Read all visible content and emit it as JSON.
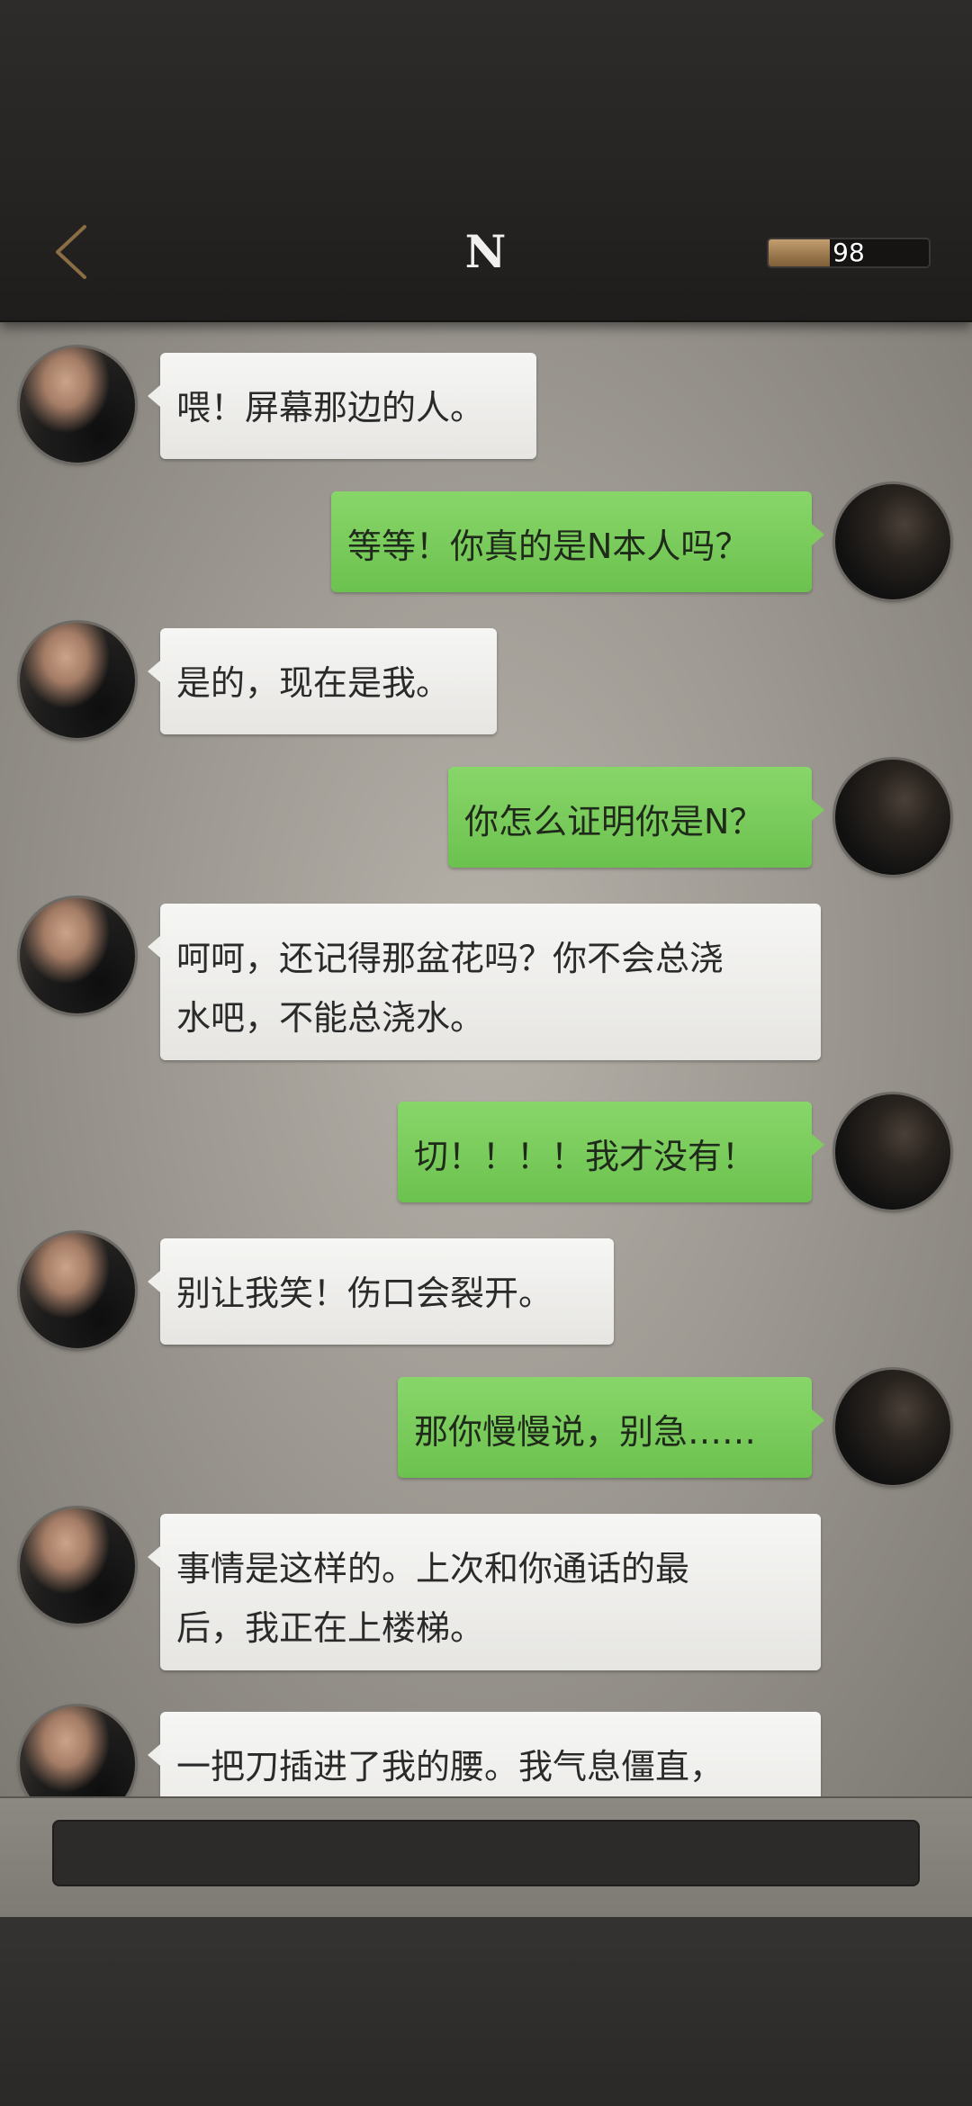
{
  "header": {
    "title": "N",
    "back_icon": "chevron-left-icon",
    "meter_value": "98",
    "meter_fill_percent": 38
  },
  "messages": [
    {
      "sender": "N",
      "side": "left",
      "lines": [
        "喂！屏幕那边的人。"
      ]
    },
    {
      "sender": "me",
      "side": "right",
      "lines": [
        "等等！你真的是N本人吗？"
      ]
    },
    {
      "sender": "N",
      "side": "left",
      "lines": [
        "是的，现在是我。"
      ]
    },
    {
      "sender": "me",
      "side": "right",
      "lines": [
        "你怎么证明你是N？"
      ]
    },
    {
      "sender": "N",
      "side": "left",
      "lines": [
        "呵呵，还记得那盆花吗？你不会总浇",
        "水吧，不能总浇水。"
      ]
    },
    {
      "sender": "me",
      "side": "right",
      "lines": [
        "切！！！！我才没有！"
      ]
    },
    {
      "sender": "N",
      "side": "left",
      "lines": [
        "别让我笑！伤口会裂开。"
      ]
    },
    {
      "sender": "me",
      "side": "right",
      "lines": [
        "那你慢慢说，别急……"
      ]
    },
    {
      "sender": "N",
      "side": "left",
      "lines": [
        "事情是这样的。上次和你通话的最",
        "后，我正在上楼梯。"
      ]
    },
    {
      "sender": "N",
      "side": "left",
      "lines": [
        "一把刀插进了我的腰。我气息僵直，"
      ]
    }
  ],
  "input": {
    "value": "",
    "placeholder": ""
  },
  "colors": {
    "accent_gold": "#a9864f",
    "bubble_green": "#7ccd5d",
    "bubble_white": "#eeeeeb"
  }
}
